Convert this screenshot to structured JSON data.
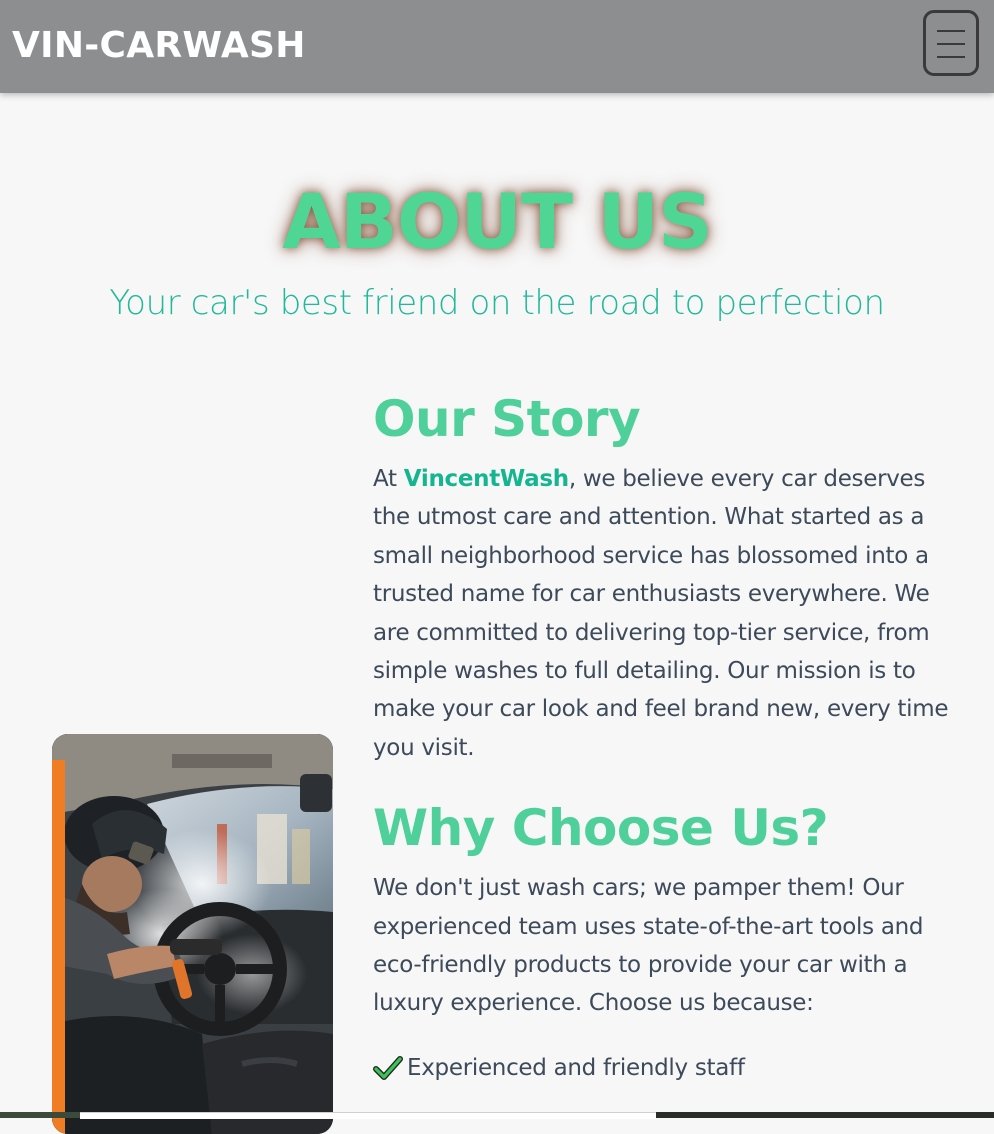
{
  "navbar": {
    "brand": "VIN-CARWASH",
    "menu_icon": "hamburger-menu-icon",
    "background": "#8c8e90"
  },
  "hero": {
    "title": "ABOUT US",
    "subtitle": "Your car's best friend on the road to perfection",
    "title_color": "#4fd694",
    "subtitle_color": "#22b99a"
  },
  "story": {
    "heading": "Our Story",
    "intro": "At ",
    "brand_name": "VincentWash",
    "body": ", we believe every car deserves the utmost care and attention. What started as a small neighborhood service has blossomed into a trusted name for car enthusiasts everywhere. We are committed to delivering top-tier service, from simple washes to full detailing. Our mission is to make your car look and feel brand new, every time you visit."
  },
  "why": {
    "heading": "Why Choose Us?",
    "body": "We don't just wash cars; we pamper them! Our experienced team uses state-of-the-art tools and eco-friendly products to provide your car with a luxury experience. Choose us because:",
    "items": [
      {
        "icon": "checkmark-icon",
        "label": "Experienced and friendly staff"
      }
    ]
  },
  "photo": {
    "subject": "Worker steam-cleaning a car's interior and steering wheel",
    "accent_color": "#f07d24"
  },
  "colors": {
    "heading": "#4fd09b",
    "text": "#3d4a5a",
    "brand_inline": "#14b58f"
  }
}
